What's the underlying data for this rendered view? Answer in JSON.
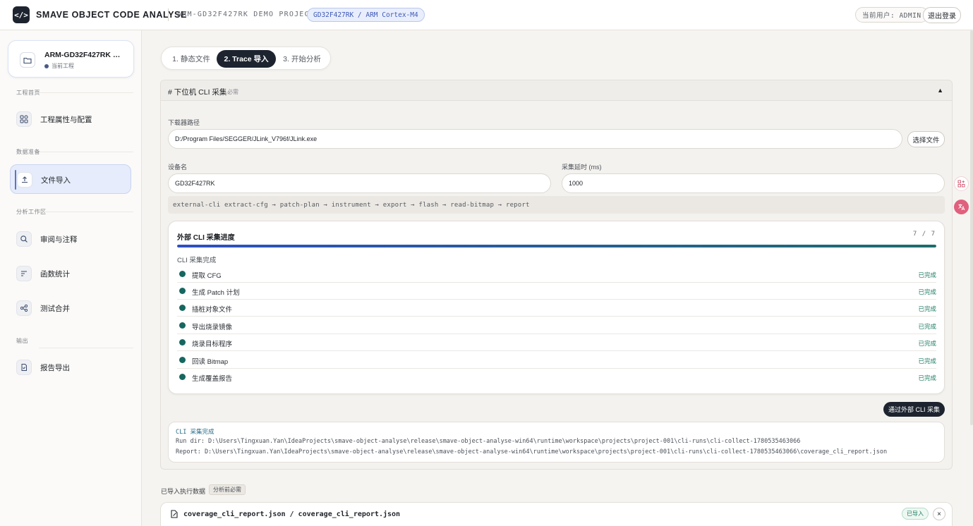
{
  "header": {
    "app_title": "SMAVE OBJECT CODE ANALYSE",
    "project_name": "ARM-GD32F427RK DEMO PROJECT",
    "target": "GD32F427RK / ARM Cortex-M4",
    "current_user": "当前用户: ADMIN",
    "logout": "退出登录",
    "logo_glyph": "</>"
  },
  "sidebar": {
    "project_card": {
      "title": "ARM-GD32F427RK D...",
      "subtitle": "当前工程"
    },
    "sections": [
      {
        "label": "工程首页",
        "items": [
          {
            "label": "工程属性与配置",
            "icon": "grid-settings-icon"
          }
        ]
      },
      {
        "label": "数据准备",
        "items": [
          {
            "label": "文件导入",
            "icon": "upload-icon",
            "active": true
          }
        ]
      },
      {
        "label": "分析工作区",
        "items": [
          {
            "label": "审阅与注释",
            "icon": "search-icon"
          },
          {
            "label": "函数统计",
            "icon": "list-icon"
          },
          {
            "label": "测试合并",
            "icon": "share-icon"
          }
        ]
      },
      {
        "label": "输出",
        "items": [
          {
            "label": "报告导出",
            "icon": "document-icon"
          }
        ]
      }
    ]
  },
  "tabs": [
    {
      "label": "1. 静态文件",
      "active": false
    },
    {
      "label": "2. Trace 导入",
      "active": true
    },
    {
      "label": "3. 开始分析",
      "active": false
    }
  ],
  "panel": {
    "title": "#  下位机 CLI 采集",
    "required": "必需",
    "downloader_label": "下载器路径",
    "downloader_value": "D:/Program Files/SEGGER/JLink_V796f/JLink.exe",
    "choose_file": "选择文件",
    "device_label": "设备名",
    "device_value": "GD32F427RK",
    "delay_label": "采集延时 (ms)",
    "delay_value": "1000",
    "pipeline": "external-cli extract-cfg → patch-plan → instrument → export → flash → read-bitmap → report"
  },
  "progress": {
    "title": "外部 CLI 采集进度",
    "count": "7 / 7",
    "percent": 100,
    "status": "CLI 采集完成",
    "steps": [
      {
        "label": "提取 CFG",
        "state": "已完成"
      },
      {
        "label": "生成 Patch 计划",
        "state": "已完成"
      },
      {
        "label": "插桩对象文件",
        "state": "已完成"
      },
      {
        "label": "导出烧录镜像",
        "state": "已完成"
      },
      {
        "label": "烧录目标程序",
        "state": "已完成"
      },
      {
        "label": "回读 Bitmap",
        "state": "已完成"
      },
      {
        "label": "生成覆盖报告",
        "state": "已完成"
      }
    ]
  },
  "collect_button": "通过外部 CLI 采集",
  "log": {
    "line1": "CLI 采集完成",
    "line2": "Run dir: D:\\Users\\Tingxuan.Yan\\IdeaProjects\\smave-object-analyse\\release\\smave-object-analyse-win64\\runtime\\workspace\\projects\\project-001\\cli-runs\\cli-collect-1780535463066",
    "line3": "Report: D:\\Users\\Tingxuan.Yan\\IdeaProjects\\smave-object-analyse\\release\\smave-object-analyse-win64\\runtime\\workspace\\projects\\project-001\\cli-runs\\cli-collect-1780535463066\\coverage_cli_report.json"
  },
  "imported": {
    "label": "已导入执行数据",
    "chip": "分析前必需",
    "file_name": "coverage_cli_report.json / coverage_cli_report.json",
    "badge": "已导入",
    "remove": "×"
  },
  "colors": {
    "accent": "#1d2430",
    "brand_blue": "#3f5bb8",
    "success": "#1f7a62",
    "step_dot": "#16675f"
  }
}
